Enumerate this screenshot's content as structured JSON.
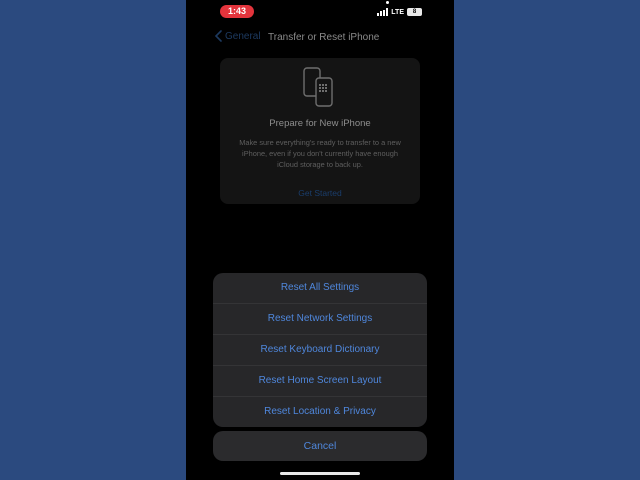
{
  "status_bar": {
    "time": "1:43",
    "network": "LTE",
    "battery": "8"
  },
  "nav": {
    "back_label": "General",
    "title": "Transfer or Reset iPhone"
  },
  "prepare_card": {
    "title": "Prepare for New iPhone",
    "description": "Make sure everything's ready to transfer to a new iPhone, even if you don't currently have enough iCloud storage to back up.",
    "action": "Get Started"
  },
  "action_sheet": {
    "items": [
      {
        "label": "Reset All Settings"
      },
      {
        "label": "Reset Network Settings"
      },
      {
        "label": "Reset Keyboard Dictionary"
      },
      {
        "label": "Reset Home Screen Layout"
      },
      {
        "label": "Reset Location & Privacy"
      }
    ],
    "cancel": "Cancel"
  },
  "colors": {
    "background": "#2b4a7f",
    "accent": "#4f87dc",
    "time_pill": "#e3343c"
  }
}
